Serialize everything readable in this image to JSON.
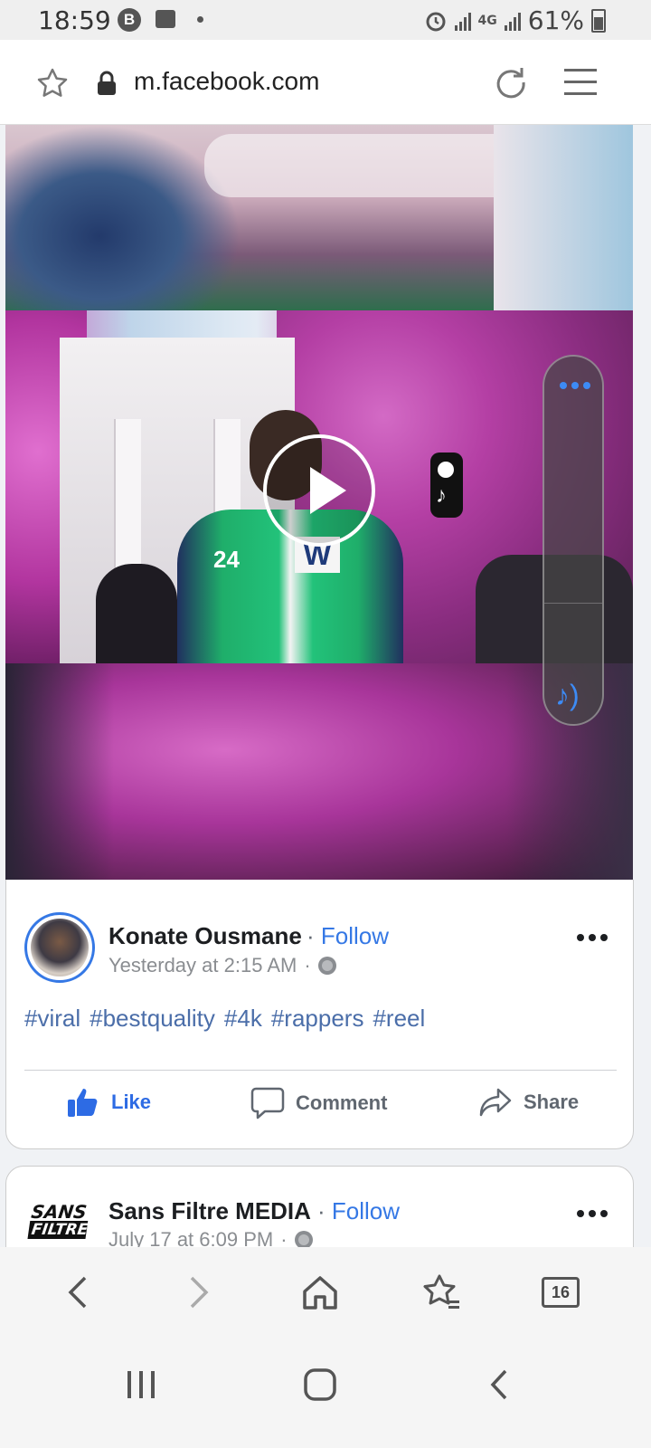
{
  "status_bar": {
    "time": "18:59",
    "badge_letter": "B",
    "network": "4G",
    "battery": "61%"
  },
  "browser": {
    "url": "m.facebook.com",
    "tab_count": "16"
  },
  "post": {
    "author": "Konate Ousmane",
    "follow_label": "Follow",
    "timestamp": "Yesterday at 2:15 AM",
    "separator": "·",
    "hashtags": [
      "#viral",
      "#bestquality",
      "#4k",
      "#rappers",
      "#reel"
    ],
    "actions": {
      "like": "Like",
      "comment": "Comment",
      "share": "Share"
    }
  },
  "next_post": {
    "author": "Sans Filtre MEDIA",
    "follow_label": "Follow",
    "timestamp": "July 17 at 6:09 PM",
    "logo_text_1": "SANS",
    "logo_text_2": "FILTRE"
  },
  "video": {
    "tiktok_label": "TikTok",
    "jacket_number": "24",
    "jacket_letter": "W"
  },
  "colors": {
    "facebook_blue": "#3578e5",
    "hashtag_blue": "#4b6ea9",
    "pill_accent": "#3d8bf5"
  }
}
